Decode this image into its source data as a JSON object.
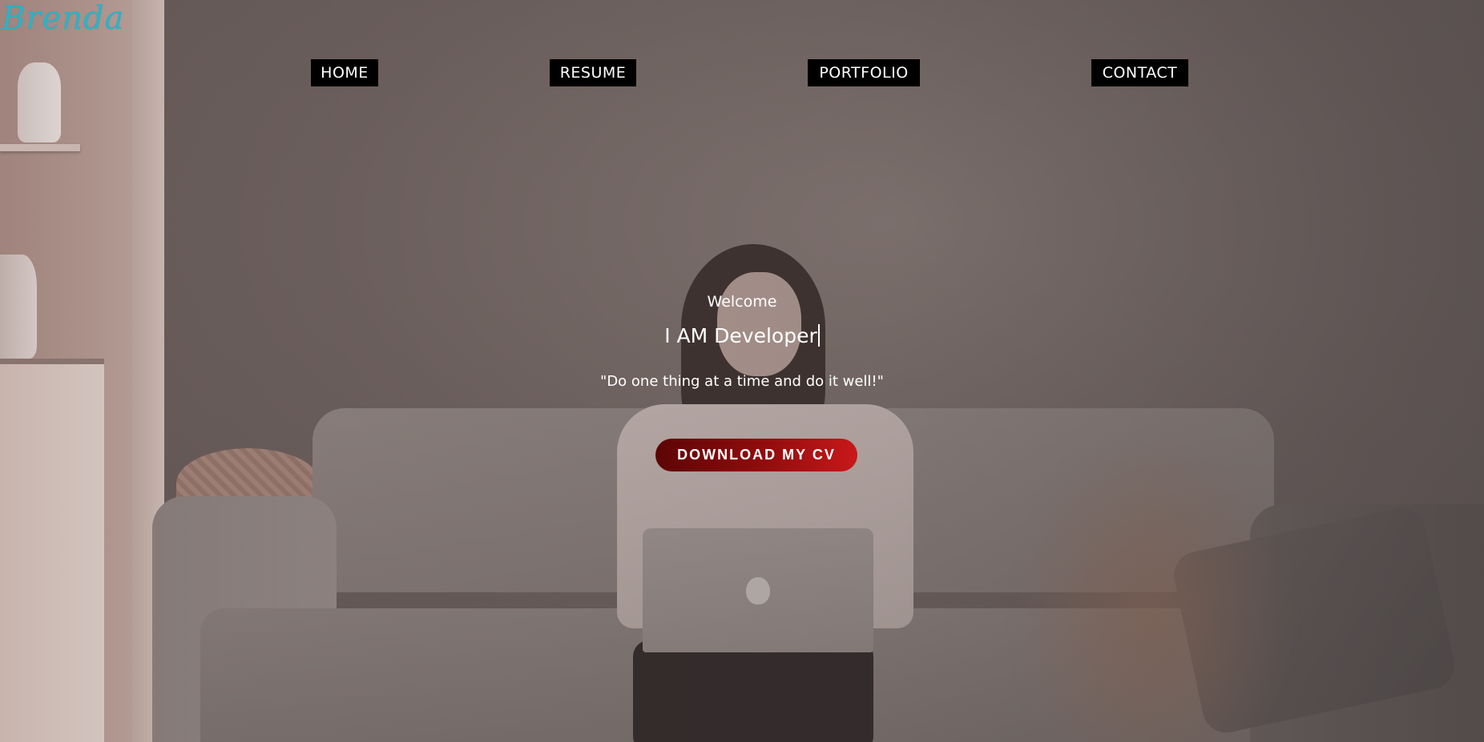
{
  "brand": {
    "logo_text": "Brenda",
    "logo_color": "#29b4c9"
  },
  "nav": {
    "items": [
      {
        "label": "HOME"
      },
      {
        "label": "RESUME"
      },
      {
        "label": "PORTFOLIO"
      },
      {
        "label": "CONTACT"
      }
    ],
    "item_background": "#000000",
    "item_text_color": "#ffffff"
  },
  "hero": {
    "welcome": "Welcome",
    "role_text": "I AM Developer",
    "quote": "\"Do one thing at a time and do it well!\"",
    "cta_label": "DOWNLOAD MY CV",
    "cta_gradient": [
      "#5c0506",
      "#c8181a"
    ]
  },
  "background": {
    "description_icon": "person-on-sofa-with-laptop-photo"
  }
}
